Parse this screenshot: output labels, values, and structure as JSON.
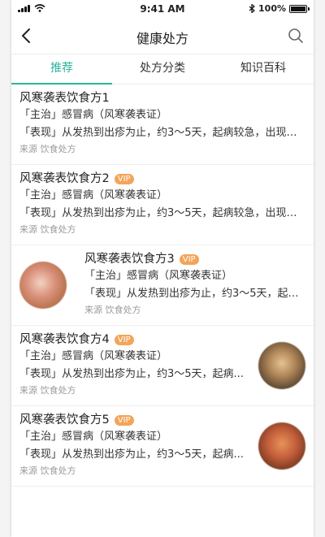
{
  "status_bar": {
    "time": "9:41 AM",
    "battery": "100%",
    "battery_level": 1.0
  },
  "nav": {
    "title": "健康处方"
  },
  "tabs": [
    {
      "label": "推荐",
      "active": true
    },
    {
      "label": "处方分类",
      "active": false
    },
    {
      "label": "知识百科",
      "active": false
    }
  ],
  "items": [
    {
      "title": "风寒袭表饮食方1",
      "vip": "",
      "indication": "「主治」感冒病（风寒袭表证）",
      "symptom": "「表现」从发热到出疹为止，约3～5天，起病较急，出现发...",
      "source": "来源 饮食处方"
    },
    {
      "title": "风寒袭表饮食方2",
      "vip": "VIP",
      "indication": "「主治」感冒病（风寒袭表证）",
      "symptom": "「表现」从发热到出疹为止，约3～5天，起病较急，出现发...",
      "source": "来源 饮食处方"
    },
    {
      "title": "风寒袭表饮食方3",
      "vip": "VIP",
      "indication": "「主治」感冒病（风寒袭表证）",
      "symptom": "「表现」从发热到出疹为止，约3～5天，起病...",
      "source": "来源 饮食处方"
    },
    {
      "title": "风寒袭表饮食方4",
      "vip": "VIP",
      "indication": "「主治」感冒病（风寒袭表证）",
      "symptom": "「表现」从发热到出疹为止，约3～5天，起病...",
      "source": "来源 饮食处方"
    },
    {
      "title": "风寒袭表饮食方5",
      "vip": "VIP",
      "indication": "「主治」感冒病（风寒袭表证）",
      "symptom": "「表现」从发热到出疹为止，约3～5天，起病...",
      "source": "来源 饮食处方"
    }
  ],
  "colors": {
    "accent": "#29b59b",
    "vip_badge": "#f3a55a",
    "source_text": "#9a9a9a"
  },
  "icons": {
    "back": "chevron-left-icon",
    "search": "search-icon",
    "wifi": "wifi-icon",
    "bluetooth": "bluetooth-icon",
    "battery": "battery-icon"
  }
}
